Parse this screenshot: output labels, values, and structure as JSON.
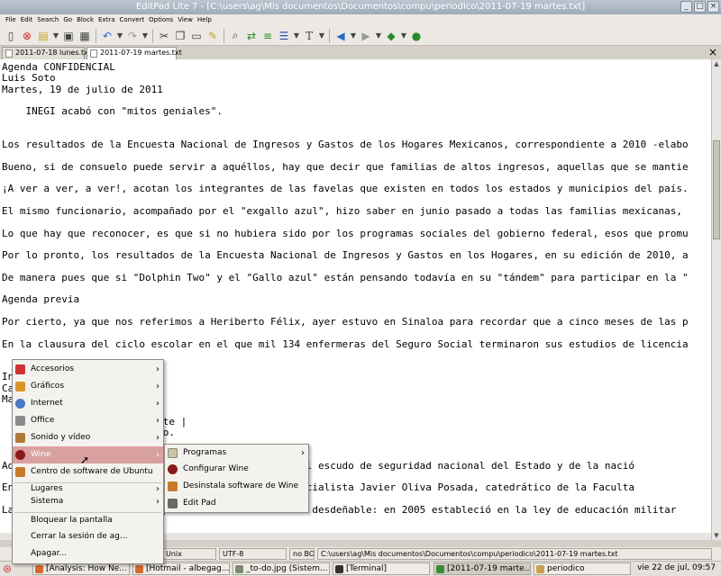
{
  "window": {
    "title": "EditPad Lite 7 - [C:\\users\\ag\\Mis documentos\\Documentos\\compu\\periodico\\2011-07-19 martes.txt]",
    "buttons": [
      "_",
      "□",
      "×"
    ]
  },
  "menubar": [
    "File",
    "Edit",
    "Search",
    "Go",
    "Block",
    "Extra",
    "Convert",
    "Options",
    "View",
    "Help"
  ],
  "toolbar_icons": [
    "new-file-icon",
    "close-file-icon",
    "open-icon",
    "save-icon",
    "print-icon",
    "undo-icon",
    "redo-icon",
    "cut-icon",
    "copy-icon",
    "paste-icon",
    "clipboard-icon",
    "search-icon",
    "replace-icon",
    "block-icon",
    "wrap-icon",
    "font-icon",
    "back-icon",
    "forward-icon",
    "bookmark-icon",
    "web-icon"
  ],
  "tabs": [
    {
      "label": "2011-07-18 lunes.txt",
      "active": false
    },
    {
      "label": "2011-07-19 martes.txt",
      "active": true
    }
  ],
  "tab_close": "×",
  "editor_lines": [
    "Agenda CONFIDENCIAL",
    "Luis Soto",
    "Martes, 19 de julio de 2011",
    "",
    "    INEGI acabó con \"mitos geniales\".",
    "",
    "",
    "Los resultados de la Encuesta Nacional de Ingresos y Gastos de los Hogares Mexicanos, correspondiente a 2010 -elabo",
    "",
    "Bueno, si de consuelo puede servir a aquéllos, hay que decir que familias de altos ingresos, aquellas que se mantie",
    "",
    "¡A ver a ver, a ver!, acotan los integrantes de las favelas que existen en todos los estados y municipios del país.",
    "",
    "El mismo funcionario, acompañado por el \"exgallo azul\", hizo saber en junio pasado a todas las familias mexicanas, ",
    "",
    "Lo que hay que reconocer, es que si no hubiera sido por los programas sociales del gobierno federal, esos que promu",
    "",
    "Por lo pronto, los resultados de la Encuesta Nacional de Ingresos y Gastos en los Hogares, en su edición de 2010, a",
    "",
    "De manera pues que si \"Dolphin Two\" y el \"Gallo azul\" están pensando todavía en su \"tándem\" para participar en la \"",
    "",
    "Agenda previa",
    "",
    "Por cierto, ya que nos referimos a Heriberto Félix, ayer estuvo en Sinaloa para recordar que a cinco meses de las p",
    "",
    "En la clausura del ciclo escolar en el que mil 134 enfermeras del Seguro Social terminaron sus estudios de licencia",
    "",
    "",
    "In",
    "Ca",
    "Ma                      1",
    "",
    "                        Corte |",
    "                        cito.",
    "",
    "",
    "Ad                                       debilita el escudo de seguridad nacional del Estado y de la nació",
    "",
    "En                                       o, el especialista Javier Oliva Posada, catedrático de la Faculta",
    "",
    "La                      ecupera Oliva Posadas no es desdeñable: en 2005 estableció en la ley de educación militar"
  ],
  "statusbar": {
    "left": "",
    "encoding_os": "Unix",
    "charset": "UTF-8",
    "bom": "no BOM",
    "path": "C:\\users\\ag\\Mis documentos\\Documentos\\compu\\periodico\\2011-07-19 martes.txt"
  },
  "main_menu": [
    {
      "label": "Accesorios",
      "icon": "accessories-icon",
      "submenu": true
    },
    {
      "label": "Gráficos",
      "icon": "graphics-icon",
      "submenu": true
    },
    {
      "label": "Internet",
      "icon": "internet-icon",
      "submenu": true
    },
    {
      "label": "Office",
      "icon": "office-icon",
      "submenu": true
    },
    {
      "label": "Sonido y vídeo",
      "icon": "sound-video-icon",
      "submenu": true
    },
    {
      "label": "Wine",
      "icon": "wine-icon",
      "submenu": true,
      "highlighted": true
    },
    {
      "label": "Centro de software de Ubuntu",
      "icon": "software-center-icon",
      "submenu": false
    }
  ],
  "places_menu": [
    {
      "label": "Lugares",
      "submenu": true
    },
    {
      "label": "Sistema",
      "submenu": true
    }
  ],
  "session_menu": [
    {
      "label": "Bloquear la pantalla"
    },
    {
      "label": "Cerrar la sesión de ag..."
    },
    {
      "label": "Apagar..."
    }
  ],
  "wine_menu": [
    {
      "label": "Programas",
      "icon": "folder-icon",
      "submenu": true
    },
    {
      "label": "Configurar Wine",
      "icon": "wine-config-icon",
      "submenu": false
    },
    {
      "label": "Desinstala software de Wine",
      "icon": "uninstall-icon",
      "submenu": false
    },
    {
      "label": "Edit Pad",
      "icon": "editpad-icon",
      "submenu": false
    }
  ],
  "taskbar": [
    {
      "label": "[Analysis: How Ne...",
      "color": "#d86a2c"
    },
    {
      "label": "[Hotmail - albegag...",
      "color": "#d86a2c"
    },
    {
      "label": "_to-do.jpg (Sistem...",
      "color": "#7a8a6a"
    },
    {
      "label": "[Terminal]",
      "color": "#333333"
    },
    {
      "label": "[2011-07-19 marte...",
      "color": "#3a8a3a",
      "active": true
    },
    {
      "label": "periodico",
      "color": "#c8a050"
    }
  ],
  "clock": "vie 22 de jul, 09:57",
  "colors": {
    "highlight": "#d9a0a0",
    "menu_bg": "#f4f2ee",
    "editor_bg": "#ffffff"
  }
}
